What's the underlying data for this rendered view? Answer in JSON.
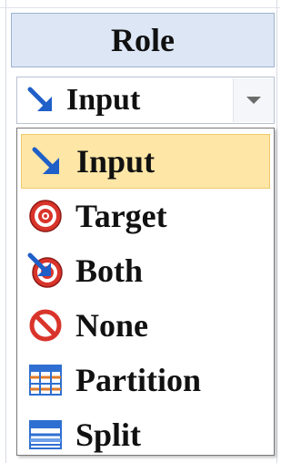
{
  "header": {
    "title": "Role"
  },
  "combo": {
    "value": "Input",
    "icon": "input-arrow-icon"
  },
  "dropdown": {
    "options": [
      {
        "label": "Input",
        "icon": "input-arrow-icon",
        "selected": true
      },
      {
        "label": "Target",
        "icon": "target-icon",
        "selected": false
      },
      {
        "label": "Both",
        "icon": "both-icon",
        "selected": false
      },
      {
        "label": "None",
        "icon": "none-icon",
        "selected": false
      },
      {
        "label": "Partition",
        "icon": "partition-icon",
        "selected": false
      },
      {
        "label": "Split",
        "icon": "split-icon",
        "selected": false
      }
    ]
  },
  "colors": {
    "header_bg": "#dce6f4",
    "selected_bg": "#fde6a6",
    "arrow_blue": "#1f5fc8",
    "target_red": "#d9342b"
  }
}
